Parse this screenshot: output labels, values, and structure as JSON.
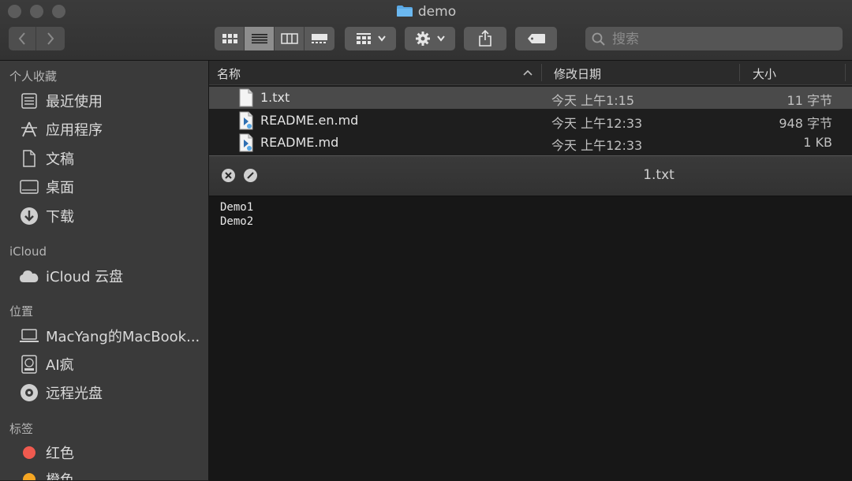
{
  "window": {
    "title": "demo"
  },
  "toolbar": {
    "back_icon": "chevron-left-icon",
    "forward_icon": "chevron-right-icon",
    "view_modes": [
      "icon-view",
      "list-view",
      "column-view",
      "gallery-view"
    ],
    "active_view": "list-view",
    "search_placeholder": "搜索"
  },
  "sidebar": {
    "favorites_header": "个人收藏",
    "favorites": [
      {
        "label": "最近使用",
        "icon": "recents-icon"
      },
      {
        "label": "应用程序",
        "icon": "applications-icon"
      },
      {
        "label": "文稿",
        "icon": "documents-icon"
      },
      {
        "label": "桌面",
        "icon": "desktop-icon"
      },
      {
        "label": "下载",
        "icon": "downloads-icon"
      }
    ],
    "icloud_header": "iCloud",
    "icloud": [
      {
        "label": "iCloud 云盘",
        "icon": "cloud-icon"
      }
    ],
    "locations_header": "位置",
    "locations": [
      {
        "label": "MacYang的MacBook...",
        "icon": "laptop-icon"
      },
      {
        "label": "AI疯",
        "icon": "disk-icon"
      },
      {
        "label": "远程光盘",
        "icon": "optical-disc-icon"
      }
    ],
    "tags_header": "标签",
    "tags": [
      {
        "label": "红色",
        "color": "#f05a4f"
      },
      {
        "label": "橙色",
        "color": "#f5a623"
      }
    ]
  },
  "list": {
    "columns": {
      "name": "名称",
      "date": "修改日期",
      "size": "大小"
    },
    "files": [
      {
        "name": "1.txt",
        "date": "今天 上午1:15",
        "size": "11 字节",
        "icon": "text-file-icon",
        "selected": true
      },
      {
        "name": "README.en.md",
        "date": "今天 上午12:33",
        "size": "948 字节",
        "icon": "markdown-file-icon",
        "selected": false
      },
      {
        "name": "README.md",
        "date": "今天 上午12:33",
        "size": "1 KB",
        "icon": "markdown-file-icon",
        "selected": false
      }
    ]
  },
  "quicklook": {
    "title": "1.txt",
    "lines": [
      "Demo1",
      "Demo2"
    ]
  },
  "colors": {
    "selection": "#4a4a4a",
    "tag_red": "#f05a4f",
    "tag_orange": "#f5a623",
    "folder_blue": "#5aa9e6"
  }
}
